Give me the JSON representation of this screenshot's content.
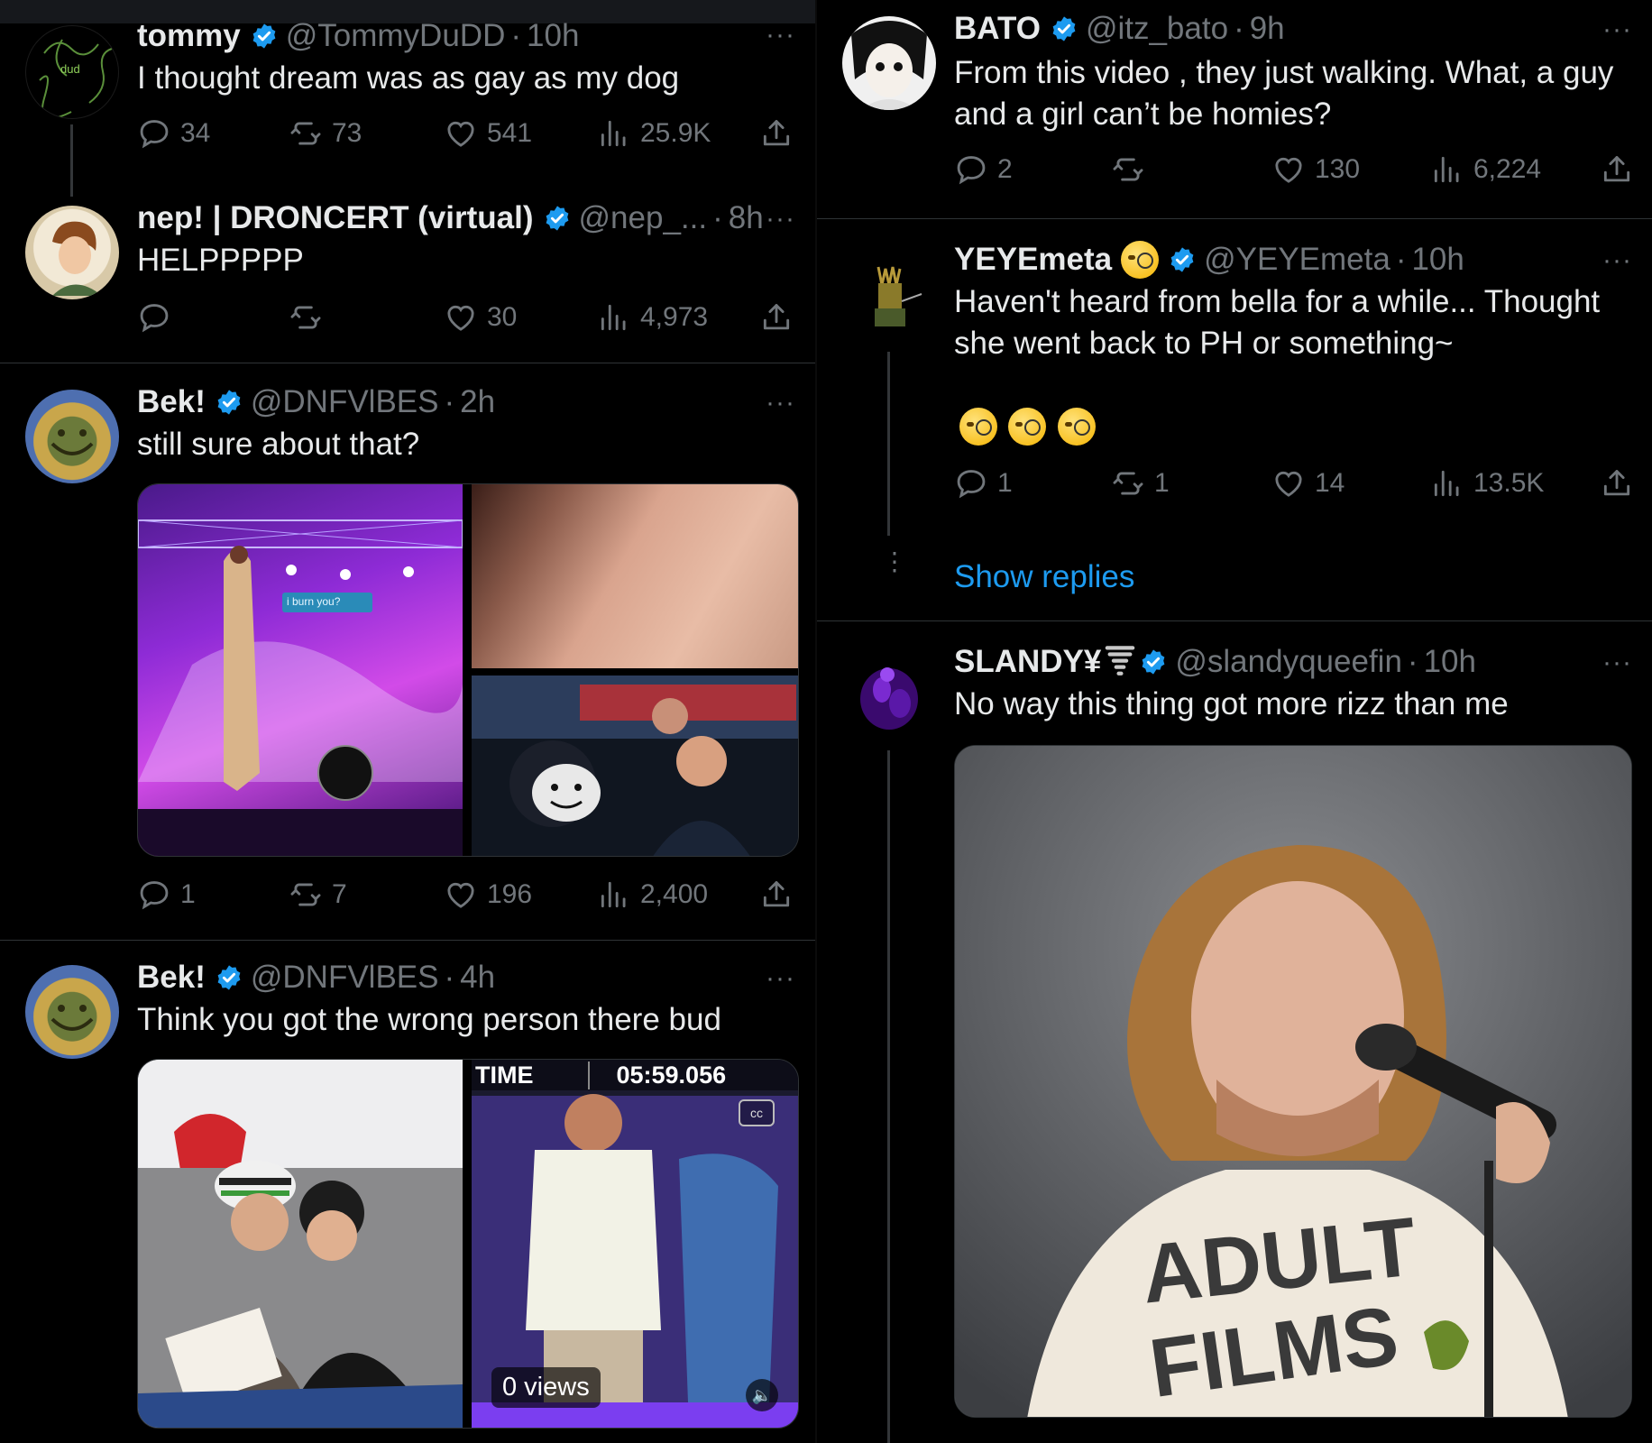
{
  "left_column": {
    "tweets": [
      {
        "name": "tommy",
        "handle": "@TommyDuDD",
        "time": "10h",
        "text": "I thought dream was as gay as my dog",
        "replies": "34",
        "reposts": "73",
        "likes": "541",
        "views": "25.9K",
        "avatar_text": "dud"
      },
      {
        "name": "nep! | DRONCERT (virtual)",
        "handle": "@nep_...",
        "time": "8h",
        "text": "HELPPPPP",
        "replies": "",
        "reposts": "",
        "likes": "30",
        "views": "4,973"
      },
      {
        "name": "Bek!",
        "handle": "@DNFVlBES",
        "time": "2h",
        "text": "still sure about that?",
        "replies": "1",
        "reposts": "7",
        "likes": "196",
        "views": "2,400",
        "media_caption": "i burn you?"
      },
      {
        "name": "Bek!",
        "handle": "@DNFVlBES",
        "time": "4h",
        "text": "Think you got the wrong person there bud",
        "media_time_label": "TIME",
        "media_time_value": "05:59.056",
        "media_views": "0 views",
        "media_cc": "cc"
      }
    ]
  },
  "right_column": {
    "tweets": [
      {
        "name": "BATO",
        "handle": "@itz_bato",
        "time": "9h",
        "text_line1": "From this video , they just walking. What, a guy",
        "text_line2": "and a girl can’t be homies?",
        "replies": "2",
        "reposts": "",
        "likes": "130",
        "views": "6,224"
      },
      {
        "name": "YEYEmeta",
        "handle": "@YEYEmeta",
        "time": "10h",
        "text_line1": "Haven't heard from bella for a while... Thought",
        "text_line2": "she went back to PH or something~",
        "replies": "1",
        "reposts": "1",
        "likes": "14",
        "views": "13.5K",
        "show_replies": "Show replies"
      },
      {
        "name": "SLANDY¥",
        "handle": "@slandyqueefin",
        "time": "10h",
        "text": "No way this thing got more rizz than me",
        "shirt_text_line1": "ADULT",
        "shirt_text_line2": "FILMS"
      }
    ]
  },
  "ui": {
    "more_glyph": "···",
    "separator_dot": "·"
  },
  "colors": {
    "background": "#000000",
    "text": "#e7e9ea",
    "muted": "#71767b",
    "accent": "#1d9bf0",
    "divider": "#2f3336"
  },
  "icons": [
    "reply-icon",
    "repost-icon",
    "like-icon",
    "views-icon",
    "share-icon",
    "verified-badge-icon",
    "more-icon"
  ]
}
